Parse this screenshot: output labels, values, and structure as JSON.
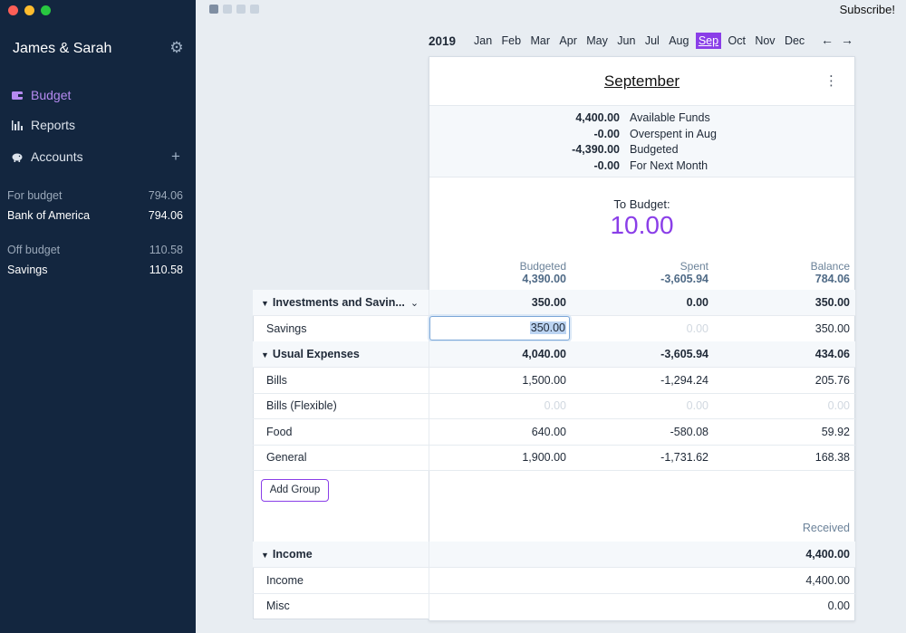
{
  "sidebar": {
    "budget_name": "James & Sarah",
    "nav": {
      "budget": "Budget",
      "reports": "Reports",
      "accounts": "Accounts"
    },
    "for_budget": {
      "label": "For budget",
      "amount": "794.06"
    },
    "for_budget_accounts": [
      {
        "name": "Bank of America",
        "amount": "794.06"
      }
    ],
    "off_budget": {
      "label": "Off budget",
      "amount": "110.58"
    },
    "off_budget_accounts": [
      {
        "name": "Savings",
        "amount": "110.58"
      }
    ]
  },
  "topbar": {
    "subscribe": "Subscribe!"
  },
  "calendar": {
    "year": "2019",
    "months": [
      "Jan",
      "Feb",
      "Mar",
      "Apr",
      "May",
      "Jun",
      "Jul",
      "Aug",
      "Sep",
      "Oct",
      "Nov",
      "Dec"
    ],
    "selected": "Sep",
    "prev": "←",
    "next": "→"
  },
  "month_card": {
    "title": "September",
    "summary": [
      {
        "value": "4,400.00",
        "label": "Available Funds"
      },
      {
        "value": "-0.00",
        "label": "Overspent in Aug"
      },
      {
        "value": "-4,390.00",
        "label": "Budgeted"
      },
      {
        "value": "-0.00",
        "label": "For Next Month"
      }
    ],
    "to_budget_label": "To Budget:",
    "to_budget_value": "10.00",
    "columns": {
      "budgeted": {
        "label": "Budgeted",
        "total": "4,390.00"
      },
      "spent": {
        "label": "Spent",
        "total": "-3,605.94"
      },
      "balance": {
        "label": "Balance",
        "total": "784.06"
      }
    },
    "received_label": "Received"
  },
  "groups": [
    {
      "name": "Investments and Savin...",
      "budgeted": "350.00",
      "spent": "0.00",
      "balance": "350.00",
      "categories": [
        {
          "name": "Savings",
          "budgeted": "350.00",
          "spent": "0.00",
          "balance": "350.00"
        }
      ]
    },
    {
      "name": "Usual Expenses",
      "budgeted": "4,040.00",
      "spent": "-3,605.94",
      "balance": "434.06",
      "categories": [
        {
          "name": "Bills",
          "budgeted": "1,500.00",
          "spent": "-1,294.24",
          "balance": "205.76"
        },
        {
          "name": "Bills (Flexible)",
          "budgeted": "0.00",
          "spent": "0.00",
          "balance": "0.00"
        },
        {
          "name": "Food",
          "budgeted": "640.00",
          "spent": "-580.08",
          "balance": "59.92"
        },
        {
          "name": "General",
          "budgeted": "1,900.00",
          "spent": "-1,731.62",
          "balance": "168.38"
        }
      ]
    }
  ],
  "add_group_label": "Add Group",
  "income": {
    "name": "Income",
    "received": "4,400.00",
    "categories": [
      {
        "name": "Income",
        "received": "4,400.00"
      },
      {
        "name": "Misc",
        "received": "0.00"
      }
    ]
  },
  "colors": {
    "sidebar_bg": "#13263f",
    "accent": "#8a3ee8"
  }
}
